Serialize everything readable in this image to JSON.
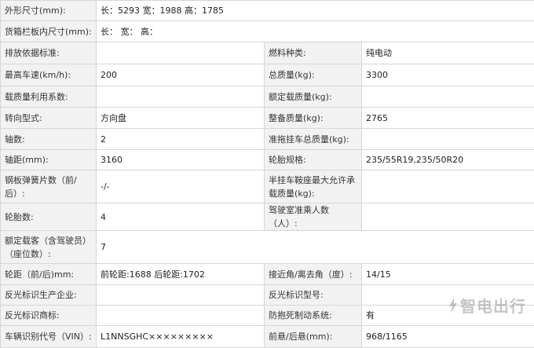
{
  "rows": [
    {
      "l1": "外形尺寸(mm):",
      "v1": "长：5293 宽：1988 高：1785",
      "l2": "",
      "v2": ""
    },
    {
      "l1": "货箱栏板内尺寸(mm):",
      "v1": "长： 宽： 高：",
      "l2": "",
      "v2": ""
    },
    {
      "l1": "排放依据标准:",
      "v1": "",
      "l2": "燃料种类:",
      "v2": "纯电动"
    },
    {
      "l1": "最高车速(km/h):",
      "v1": "200",
      "l2": "总质量(kg):",
      "v2": "3300"
    },
    {
      "l1": "载质量利用系数:",
      "v1": "",
      "l2": "额定载质量(kg):",
      "v2": ""
    },
    {
      "l1": "转向型式:",
      "v1": "方向盘",
      "l2": "整备质量(kg):",
      "v2": "2765"
    },
    {
      "l1": "轴数:",
      "v1": "2",
      "l2": "准拖挂车总质量(kg):",
      "v2": ""
    },
    {
      "l1": "轴距(mm):",
      "v1": "3160",
      "l2": "轮胎规格:",
      "v2": "235/55R19,235/50R20"
    },
    {
      "l1": "钢板弹簧片数（前/后）:",
      "v1": "-/-",
      "l2": "半挂车鞍座最大允许承载质量(kg):",
      "v2": ""
    },
    {
      "l1": "轮胎数:",
      "v1": "4",
      "l2": "驾驶室准乘人数（人）:",
      "v2": ""
    },
    {
      "l1": "额定载客（含驾驶员）（座位数）:",
      "v1": "7",
      "l2": "",
      "v2": ""
    },
    {
      "l1": "轮距（前/后)mm:",
      "v1": "前轮距:1688 后轮距:1702",
      "l2": "接近角/离去角（度）:",
      "v2": "14/15"
    },
    {
      "l1": "反光标识生产企业:",
      "v1": "",
      "l2": "反光标识型号:",
      "v2": ""
    },
    {
      "l1": "反光标识商标:",
      "v1": "",
      "l2": "防抱死制动系统:",
      "v2": "有"
    },
    {
      "l1": "车辆识别代号（VIN）:",
      "v1": "L1NNSGHC×××××××××",
      "l2": "前悬/后悬(mm):",
      "v2": "968/1165"
    }
  ],
  "watermark": {
    "text": "智电出行",
    "icon": "lightning-bolt-icon"
  },
  "colors": {
    "label_bg": "#f2f2f2",
    "border": "#d6d6d6"
  }
}
